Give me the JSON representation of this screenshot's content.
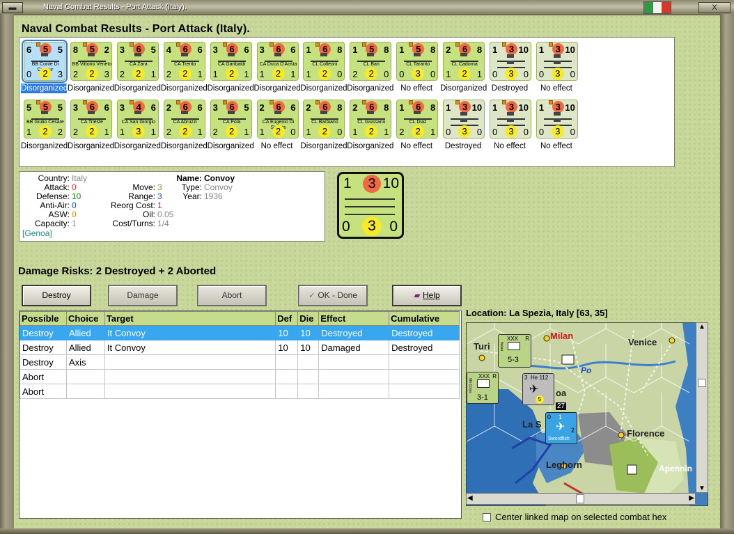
{
  "window": {
    "title": "Naval Combat Results - Port Attack (Italy).",
    "close_label": "X",
    "flag_colors": [
      "#2f9a3e",
      "#f2f2f2",
      "#d33a2e"
    ]
  },
  "heading": "Naval Combat Results - Port Attack (Italy).",
  "units_row1": [
    {
      "tl": "6",
      "mid": "5",
      "tr": "5",
      "name": "BB Conte Di Cavour",
      "bl": "0",
      "bm": "2",
      "br": "3",
      "result": "Disorganized",
      "selected": true
    },
    {
      "tl": "8",
      "mid": "5",
      "tr": "2",
      "name": "BB Vittorio Veneto",
      "bl": "2",
      "bm": "2",
      "br": "3",
      "result": "Disorganized"
    },
    {
      "tl": "3",
      "mid": "6",
      "tr": "5",
      "name": "CA Zara",
      "bl": "2",
      "bm": "2",
      "br": "1",
      "result": "Disorganized"
    },
    {
      "tl": "4",
      "mid": "6",
      "tr": "6",
      "name": "CA Trento",
      "bl": "2",
      "bm": "2",
      "br": "1",
      "result": "Disorganized"
    },
    {
      "tl": "3",
      "mid": "6",
      "tr": "6",
      "name": "CA Garibaldi",
      "bl": "1",
      "bm": "2",
      "br": "1",
      "result": "Disorganized"
    },
    {
      "tl": "3",
      "mid": "6",
      "tr": "6",
      "name": "CA Duca D'Aosta",
      "bl": "1",
      "bm": "2",
      "br": "1",
      "result": "Disorganized"
    },
    {
      "tl": "1",
      "mid": "6",
      "tr": "8",
      "name": "CL Colleoni",
      "bl": "1",
      "bm": "2",
      "br": "0",
      "result": "Disorganized"
    },
    {
      "tl": "1",
      "mid": "5",
      "tr": "8",
      "name": "CL Bari",
      "bl": "2",
      "bm": "2",
      "br": "0",
      "result": "Disorganized"
    },
    {
      "tl": "1",
      "mid": "5",
      "tr": "8",
      "name": "CL Taranto",
      "bl": "0",
      "bm": "3",
      "br": "0",
      "result": "No effect"
    },
    {
      "tl": "2",
      "mid": "6",
      "tr": "8",
      "name": "CL Cadorna",
      "bl": "1",
      "bm": "2",
      "br": "1",
      "result": "Disorganized"
    },
    {
      "tl": "1",
      "mid": "3",
      "tr": "10",
      "name": "",
      "bl": "0",
      "bm": "3",
      "br": "0",
      "result": "Destroyed",
      "convoy": true
    },
    {
      "tl": "1",
      "mid": "3",
      "tr": "10",
      "name": "",
      "bl": "0",
      "bm": "3",
      "br": "0",
      "result": "No effect",
      "convoy": true
    }
  ],
  "units_row2": [
    {
      "tl": "5",
      "mid": "5",
      "tr": "5",
      "name": "BB Giulio Cesare",
      "bl": "1",
      "bm": "2",
      "br": "2",
      "result": "Disorganized"
    },
    {
      "tl": "3",
      "mid": "6",
      "tr": "6",
      "name": "CA Trieste",
      "bl": "2",
      "bm": "2",
      "br": "1",
      "result": "Disorganized"
    },
    {
      "tl": "3",
      "mid": "4",
      "tr": "6",
      "name": "CA San Giorgio",
      "bl": "1",
      "bm": "3",
      "br": "1",
      "result": "Disorganized"
    },
    {
      "tl": "2",
      "mid": "6",
      "tr": "6",
      "name": "CA Abruzzi",
      "bl": "2",
      "bm": "2",
      "br": "1",
      "result": "Disorganized"
    },
    {
      "tl": "3",
      "mid": "6",
      "tr": "5",
      "name": "CA Pola",
      "bl": "2",
      "bm": "2",
      "br": "1",
      "result": "Disorganized"
    },
    {
      "tl": "2",
      "mid": "6",
      "tr": "6",
      "name": "CA Eugenio Di Savoia",
      "bl": "1",
      "bm": "2",
      "br": "0",
      "result": "No effect"
    },
    {
      "tl": "2",
      "mid": "6",
      "tr": "8",
      "name": "CL Barbiano",
      "bl": "1",
      "bm": "2",
      "br": "0",
      "result": "Disorganized"
    },
    {
      "tl": "2",
      "mid": "6",
      "tr": "8",
      "name": "CL Giussano",
      "bl": "1",
      "bm": "2",
      "br": "1",
      "result": "Disorganized"
    },
    {
      "tl": "1",
      "mid": "6",
      "tr": "8",
      "name": "CL Diaz",
      "bl": "2",
      "bm": "2",
      "br": "1",
      "result": "No effect"
    },
    {
      "tl": "1",
      "mid": "3",
      "tr": "10",
      "name": "",
      "bl": "0",
      "bm": "3",
      "br": "0",
      "result": "Destroyed",
      "convoy": true
    },
    {
      "tl": "1",
      "mid": "3",
      "tr": "10",
      "name": "",
      "bl": "0",
      "bm": "3",
      "br": "0",
      "result": "No effect",
      "convoy": true
    },
    {
      "tl": "1",
      "mid": "3",
      "tr": "10",
      "name": "",
      "bl": "0",
      "bm": "3",
      "br": "0",
      "result": "No effect",
      "convoy": true
    }
  ],
  "info": {
    "country_label": "Country:",
    "country": "Italy",
    "attack_label": "Attack:",
    "attack": "0",
    "defense_label": "Defense:",
    "defense": "10",
    "antiair_label": "Anti-Air:",
    "antiair": "0",
    "asw_label": "ASW:",
    "asw": "0",
    "capacity_label": "Capacity:",
    "capacity": "1",
    "port": "[Genoa]",
    "move_label": "Move:",
    "move": "3",
    "range_label": "Range:",
    "range": "3",
    "reorg_label": "Reorg Cost:",
    "reorg": "1",
    "oil_label": "Oil:",
    "oil": "0.05",
    "cost_label": "Cost/Turns:",
    "cost": "1/4",
    "name_label": "Name:",
    "name": "Convoy",
    "type_label": "Type:",
    "type": "Convoy",
    "year_label": "Year:",
    "year": "1936"
  },
  "big_counter": {
    "tl": "1",
    "tc": "3",
    "tr": "10",
    "bl": "0",
    "bc": "3",
    "br": "0"
  },
  "damage_title": "Damage Risks:  2 Destroyed + 2 Aborted",
  "buttons": {
    "destroy": "Destroy",
    "damage": "Damage",
    "abort": "Abort",
    "ok": "OK - Done",
    "help": "Help"
  },
  "table": {
    "headers": [
      "Possible",
      "Choice",
      "Target",
      "Def",
      "Die",
      "Effect",
      "Cumulative"
    ],
    "rows": [
      [
        "Destroy",
        "Allied",
        "It Convoy",
        "10",
        "10",
        "Destroyed",
        "Destroyed"
      ],
      [
        "Destroy",
        "Allied",
        "It Convoy",
        "10",
        "10",
        "Damaged",
        "Destroyed"
      ],
      [
        "Destroy",
        "Axis",
        "",
        "",
        "",
        "",
        ""
      ],
      [
        "Abort",
        "",
        "",
        "",
        "",
        "",
        ""
      ],
      [
        "Abort",
        "",
        "",
        "",
        "",
        "",
        ""
      ]
    ]
  },
  "location": "Location:  La Spezia, Italy [63, 35]",
  "map": {
    "labels": {
      "milan": "Milan",
      "venice": "Venice",
      "turin": "Turi",
      "po": "Po",
      "genoa": "oa",
      "la_spezia": "La S",
      "florence": "Florence",
      "leghorn": "Leghorn",
      "apennines": "Apennin"
    },
    "counters": {
      "army1_xxx": "XXX",
      "army1_r": "R",
      "army1_name": "Italian",
      "army1_str": "5-3",
      "army2_xxx": "XXX",
      "army2_r": "R",
      "army2_name": "6th Corps",
      "army2_str": "3-1",
      "air_tl": "3",
      "air_name": "He 112",
      "air_level": "5",
      "air_stack": "27",
      "naval_tl": "0",
      "naval_top": "1",
      "naval_name": "Swordfish",
      "naval_level": "2"
    }
  },
  "checkbox": {
    "label": "Center linked map on selected combat hex",
    "checked": false
  }
}
